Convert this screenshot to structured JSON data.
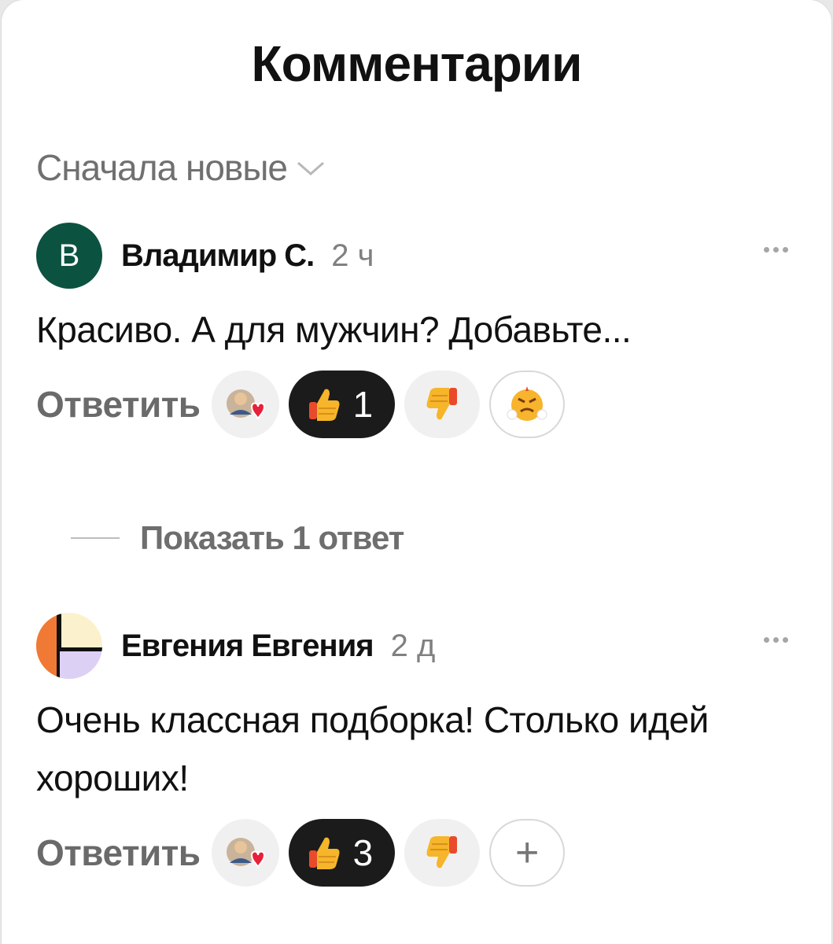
{
  "header": {
    "title": "Комментарии",
    "sort_label": "Сначала новые"
  },
  "comments": [
    {
      "avatar_letter": "В",
      "author": "Владимир С.",
      "time": "2 ч",
      "text": "Красиво. А для мужчин? Добавьте...",
      "reply_label": "Ответить",
      "reactions": {
        "thumbs_up_count": "1"
      }
    },
    {
      "author": "Евгения Евгения",
      "time": "2 д",
      "text": "Очень классная подборка! Столько идей хороших!",
      "reply_label": "Ответить",
      "reactions": {
        "thumbs_up_count": "3",
        "add_label": "+"
      }
    }
  ],
  "thread": {
    "show_replies_label": "Показать 1 ответ"
  },
  "colors": {
    "avatar_green": "#0c5240",
    "dark_pill": "#1b1b1b",
    "muted_text": "#707070"
  },
  "icons": [
    "chevron-down-icon",
    "more-icon",
    "reactions-avatar-heart-icon",
    "thumbs-up-icon",
    "thumbs-down-icon",
    "angry-face-icon",
    "plus-icon"
  ]
}
